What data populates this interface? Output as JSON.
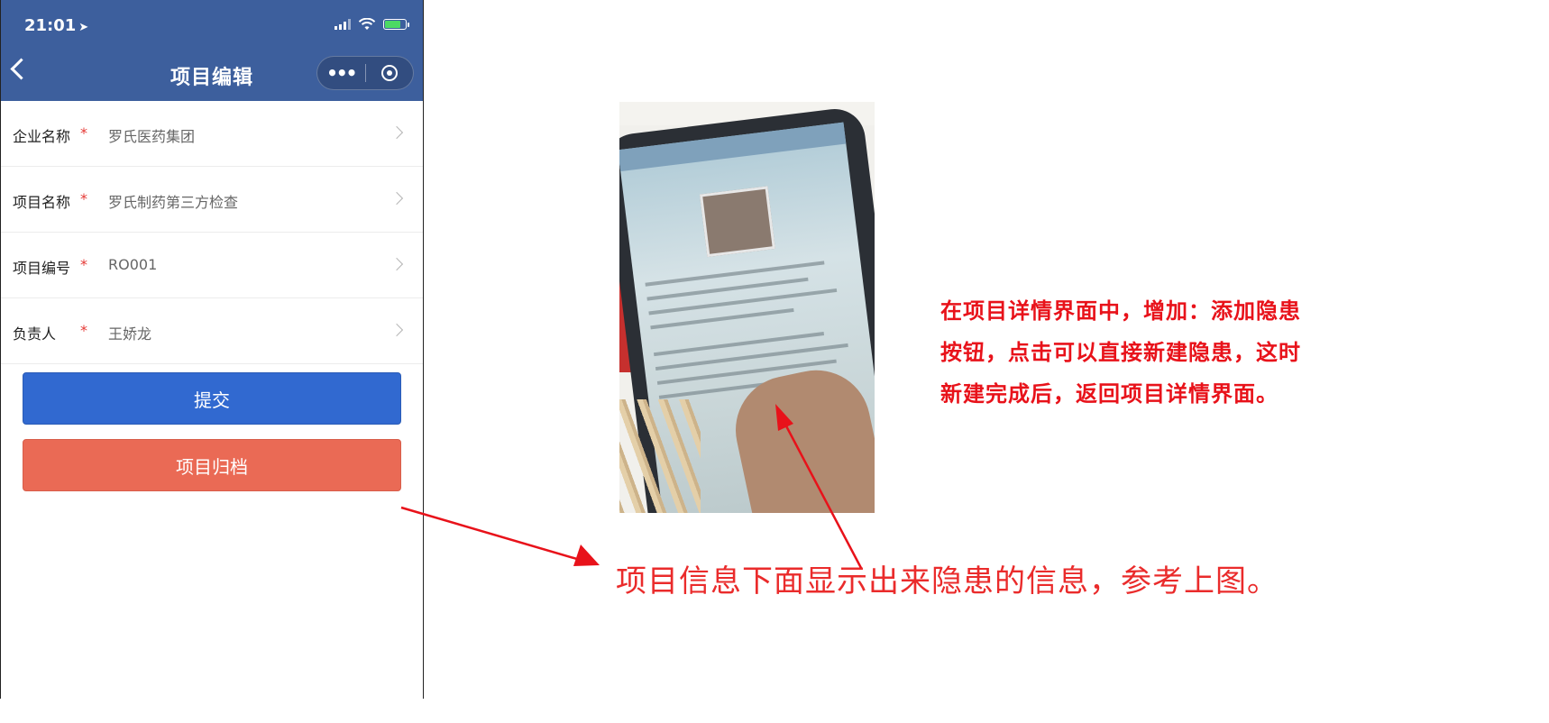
{
  "status_bar": {
    "time": "21:01"
  },
  "nav": {
    "title": "项目编辑",
    "back_icon": "chevron-left-icon",
    "more_icon": "more-dots-icon",
    "close_icon": "target-icon"
  },
  "form": {
    "required_mark": "*",
    "fields": [
      {
        "label": "企业名称",
        "value": "罗氏医药集团"
      },
      {
        "label": "项目名称",
        "value": "罗氏制药第三方检查"
      },
      {
        "label": "项目编号",
        "value": "RO001"
      },
      {
        "label": "负责人",
        "value": "王娇龙"
      }
    ]
  },
  "buttons": {
    "submit": "提交",
    "archive": "项目归档"
  },
  "colors": {
    "nav_bg": "#3d5f9d",
    "submit_bg": "#3169d0",
    "archive_bg": "#ea6a55",
    "annotation_red": "#e8121a"
  },
  "annotations": {
    "right_note_lines": [
      "在项目详情界面中，增加：添加隐患",
      "按钮，点击可以直接新建隐患，这时",
      "新建完成后，返回项目详情界面。"
    ],
    "bottom_note": "项目信息下面显示出来隐患的信息，参考上图。"
  }
}
